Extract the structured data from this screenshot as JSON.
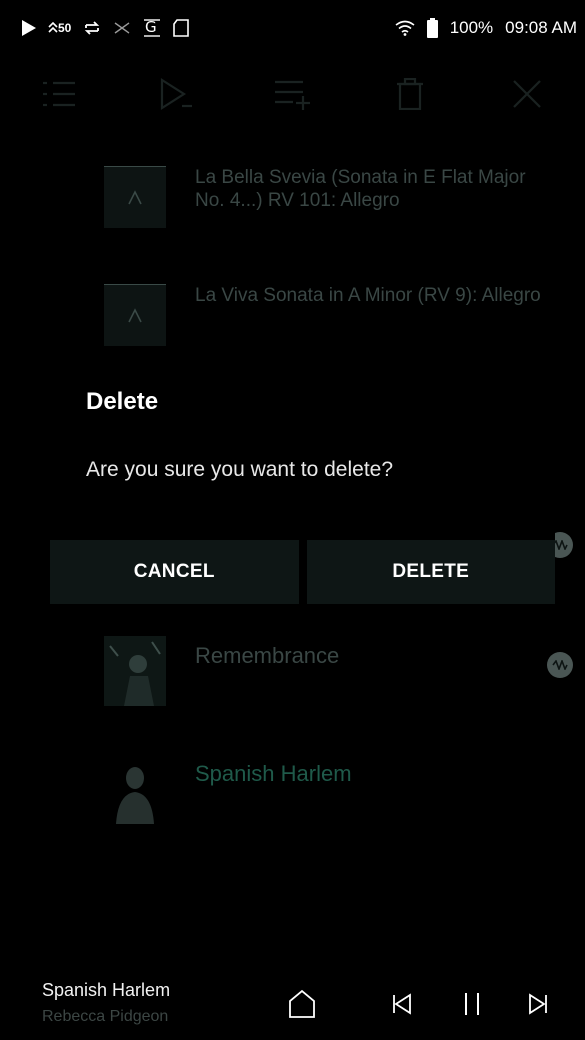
{
  "status_bar": {
    "signal_label": "50",
    "battery_percent": "100%",
    "time": "09:08 AM",
    "icons": [
      "play-icon",
      "hi-res-icon",
      "repeat-icon",
      "shuffle-icon",
      "gapless-icon",
      "sd-card-icon",
      "wifi-icon",
      "battery-icon"
    ]
  },
  "toolbar": {
    "icons": [
      "list-icon",
      "play-next-icon",
      "add-to-playlist-icon",
      "delete-icon",
      "close-icon"
    ]
  },
  "list": {
    "items": [
      {
        "title": "La Bella Svevia (Sonata in E Flat Major No. 4...) RV 101: Allegro",
        "thumb": "album-placeholder"
      },
      {
        "title": "La Viva Sonata in A Minor (RV 9): Allegro",
        "thumb": "album-placeholder"
      },
      {
        "title": "",
        "thumb": "album-art",
        "badge": "hi-res-badge"
      },
      {
        "title": "Remembrance",
        "thumb": "album-art",
        "badge": "hi-res-badge"
      },
      {
        "title": "Spanish Harlem",
        "thumb": "album-art"
      }
    ]
  },
  "dialog": {
    "title": "Delete",
    "message": "Are you sure you want to delete?",
    "cancel_label": "CANCEL",
    "delete_label": "DELETE"
  },
  "mini_player": {
    "title": "Spanish Harlem",
    "artist": "Rebecca Pidgeon"
  },
  "colors": {
    "background": "#000000",
    "dialog_button_bg": "#0e1615",
    "accent_green": "#1f5a4a"
  }
}
